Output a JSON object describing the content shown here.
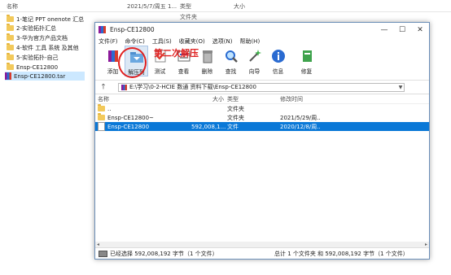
{
  "explorer": {
    "columns": {
      "name": "名称",
      "modified": "2021/5/7/周五 1...",
      "type": "类型",
      "size": "大小"
    },
    "modified_type": "文件夹",
    "items": [
      {
        "name": "1-笔记 PPT onenote 汇总",
        "icon": "folder-icon"
      },
      {
        "name": "2-实验拓扑汇总",
        "icon": "folder-icon"
      },
      {
        "name": "3-华为官方产品文档",
        "icon": "folder-icon"
      },
      {
        "name": "4-软件 工具 系统 及其他",
        "icon": "folder-icon"
      },
      {
        "name": "5-实验拓扑-自己",
        "icon": "folder-icon"
      },
      {
        "name": "Ensp-CE12800",
        "icon": "folder-icon"
      },
      {
        "name": "Ensp-CE12800.tar",
        "icon": "rar-file-icon"
      }
    ]
  },
  "window": {
    "title": "Ensp-CE12800",
    "controls": {
      "minimize": "—",
      "maximize": "☐",
      "close": "✕"
    },
    "menu": [
      "文件(F)",
      "命令(C)",
      "工具(S)",
      "收藏夹(O)",
      "选项(N)",
      "帮助(H)"
    ],
    "toolbar": [
      {
        "label": "添加",
        "icon": "add-icon"
      },
      {
        "label": "解压到",
        "icon": "extract-to-icon"
      },
      {
        "label": "测试",
        "icon": "test-icon"
      },
      {
        "label": "查看",
        "icon": "view-icon"
      },
      {
        "label": "删除",
        "icon": "delete-icon"
      },
      {
        "label": "查找",
        "icon": "find-icon"
      },
      {
        "label": "向导",
        "icon": "wizard-icon"
      },
      {
        "label": "信息",
        "icon": "info-icon"
      },
      {
        "label": "修复",
        "icon": "repair-icon"
      }
    ],
    "annotation": "第二次解压",
    "path": "E:\\学习\\0-2-HCIE 数通 资料下载\\Ensp-CE12800",
    "list_columns": {
      "name": "名称",
      "size": "大小",
      "type": "类型",
      "modified": "修改时间"
    },
    "rows": [
      {
        "name": "..",
        "size": "",
        "type": "文件夹",
        "modified": "",
        "icon": "parent-folder-icon",
        "selected": false
      },
      {
        "name": "Ensp-CE12800~",
        "size": "",
        "type": "文件夹",
        "modified": "2021/5/29/周...",
        "icon": "folder-icon",
        "selected": false
      },
      {
        "name": "Ensp-CE12800",
        "size": "592,008,1...",
        "type": "文件",
        "modified": "2020/12/8/周...",
        "icon": "file-icon",
        "selected": true
      }
    ],
    "status_left": "已经选择 592,008,192 字节（1 个文件）",
    "status_right": "总计 1 个文件夹 和 592,008,192 字节（1 个文件）"
  }
}
